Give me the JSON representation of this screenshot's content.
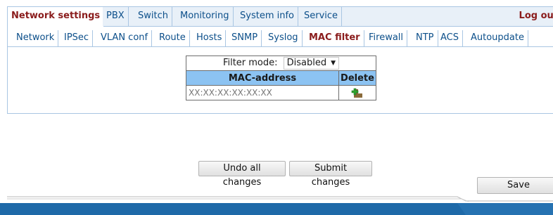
{
  "top_tabs": [
    {
      "label": "Network settings",
      "active": true
    },
    {
      "label": "PBX",
      "active": false
    },
    {
      "label": "Switch",
      "active": false
    },
    {
      "label": "Monitoring",
      "active": false
    },
    {
      "label": "System info",
      "active": false
    },
    {
      "label": "Service",
      "active": false
    }
  ],
  "logout_label": "Log out",
  "sub_tabs": [
    {
      "label": "Network",
      "active": false
    },
    {
      "label": "IPSec",
      "active": false
    },
    {
      "label": "VLAN conf",
      "active": false
    },
    {
      "label": "Route",
      "active": false
    },
    {
      "label": "Hosts",
      "active": false
    },
    {
      "label": "SNMP",
      "active": false
    },
    {
      "label": "Syslog",
      "active": false
    },
    {
      "label": "MAC filter",
      "active": true
    },
    {
      "label": "Firewall",
      "active": false
    },
    {
      "label": "NTP",
      "active": false
    },
    {
      "label": "ACS",
      "active": false
    },
    {
      "label": "Autoupdate",
      "active": false
    }
  ],
  "filter": {
    "mode_label": "Filter mode:",
    "mode_value": "Disabled",
    "col_mac": "MAC-address",
    "col_delete": "Delete",
    "mac_placeholder": "XX:XX:XX:XX:XX:XX",
    "mac_value": ""
  },
  "buttons": {
    "undo": "Undo all changes",
    "submit": "Submit changes",
    "save": "Save"
  },
  "colors": {
    "tab_text": "#0c4f8a",
    "active_text": "#8a1c1c",
    "header_fill": "#8cc3f2",
    "bottom_bar": "#1e69a8"
  }
}
